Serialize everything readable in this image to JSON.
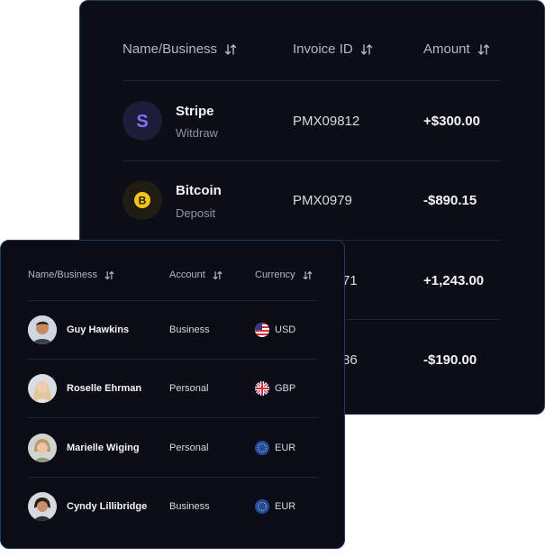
{
  "back_table": {
    "headers": [
      "Name/Business",
      "Invoice ID",
      "Amount"
    ],
    "rows": [
      {
        "name": "Stripe",
        "sub": "Witdraw",
        "invoice": "PMX09812",
        "amount": "+$300.00",
        "logo": "stripe-icon"
      },
      {
        "name": "Bitcoin",
        "sub": "Deposit",
        "invoice": "PMX0979",
        "amount": "-$890.15",
        "logo": "bitcoin-icon"
      },
      {
        "invoice_partial": "71",
        "amount": "+1,243.00"
      },
      {
        "invoice_partial": "86",
        "amount": "-$190.00"
      }
    ]
  },
  "front_table": {
    "headers": [
      "Name/Business",
      "Account",
      "Currency"
    ],
    "rows": [
      {
        "name": "Guy Hawkins",
        "account": "Business",
        "currency": "USD",
        "flag": "us-flag-icon"
      },
      {
        "name": "Roselle Ehrman",
        "account": "Personal",
        "currency": "GBP",
        "flag": "uk-flag-icon"
      },
      {
        "name": "Marielle Wiging",
        "account": "Personal",
        "currency": "EUR",
        "flag": "eu-flag-icon"
      },
      {
        "name": "Cyndy Lillibridge",
        "account": "Business",
        "currency": "EUR",
        "flag": "eu-flag-icon"
      }
    ]
  },
  "colors": {
    "background": "#0b0d17",
    "stripe": "#8b6cff",
    "bitcoin": "#f4c21a",
    "text": "#f2f4f8",
    "muted": "#8e95a6"
  }
}
